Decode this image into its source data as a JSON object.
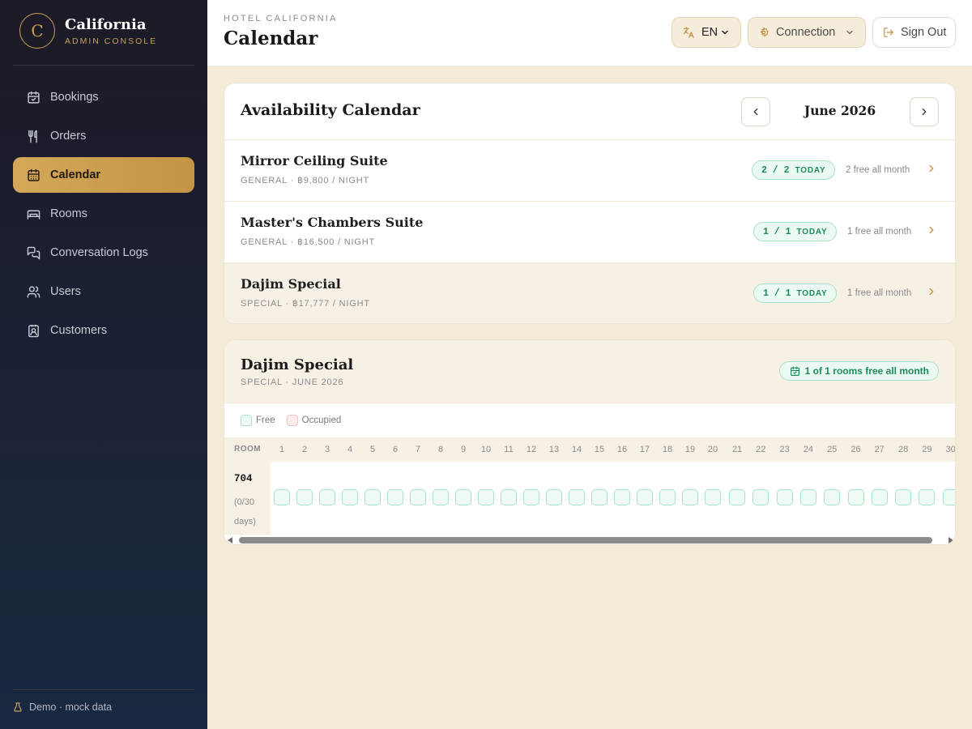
{
  "brand": {
    "logo_letter": "C",
    "title": "California",
    "subtitle": "ADMIN CONSOLE"
  },
  "nav": [
    {
      "label": "Bookings",
      "icon": "calendar-check-icon",
      "active": false
    },
    {
      "label": "Orders",
      "icon": "utensils-icon",
      "active": false
    },
    {
      "label": "Calendar",
      "icon": "calendar-icon",
      "active": true
    },
    {
      "label": "Rooms",
      "icon": "bed-icon",
      "active": false
    },
    {
      "label": "Conversation Logs",
      "icon": "chat-icon",
      "active": false
    },
    {
      "label": "Users",
      "icon": "users-icon",
      "active": false
    },
    {
      "label": "Customers",
      "icon": "contact-icon",
      "active": false
    }
  ],
  "footer": {
    "label": "Demo · mock data",
    "icon": "flask-icon"
  },
  "header": {
    "eyebrow": "HOTEL CALIFORNIA",
    "title": "Calendar",
    "lang_label": "EN",
    "connection_label": "Connection",
    "signout_label": "Sign Out"
  },
  "availability": {
    "title": "Availability Calendar",
    "month": "June 2026",
    "rooms": [
      {
        "name": "Mirror Ceiling Suite",
        "meta": "GENERAL · ฿9,800 / NIGHT",
        "badge": "2 / 2",
        "badge_suffix": "TODAY",
        "free_text": "2 free all month",
        "selected": false
      },
      {
        "name": "Master's Chambers Suite",
        "meta": "GENERAL · ฿16,500 / NIGHT",
        "badge": "1 / 1",
        "badge_suffix": "TODAY",
        "free_text": "1 free all month",
        "selected": false
      },
      {
        "name": "Dajim Special",
        "meta": "SPECIAL · ฿17,777 / NIGHT",
        "badge": "1 / 1",
        "badge_suffix": "TODAY",
        "free_text": "1 free all month",
        "selected": true
      }
    ]
  },
  "detail": {
    "title": "Dajim Special",
    "meta": "SPECIAL · JUNE 2026",
    "free_badge": "1 of 1 rooms free all month",
    "legend": {
      "free": "Free",
      "occupied": "Occupied"
    },
    "room_col_label": "ROOM",
    "days": [
      "1",
      "2",
      "3",
      "4",
      "5",
      "6",
      "7",
      "8",
      "9",
      "10",
      "11",
      "12",
      "13",
      "14",
      "15",
      "16",
      "17",
      "18",
      "19",
      "20",
      "21",
      "22",
      "23",
      "24",
      "25",
      "26",
      "27",
      "28",
      "29",
      "30"
    ],
    "room": {
      "number": "704",
      "days_text": "(0/30 days)"
    },
    "status": [
      "free",
      "free",
      "free",
      "free",
      "free",
      "free",
      "free",
      "free",
      "free",
      "free",
      "free",
      "free",
      "free",
      "free",
      "free",
      "free",
      "free",
      "free",
      "free",
      "free",
      "free",
      "free",
      "free",
      "free",
      "free",
      "free",
      "free",
      "free",
      "free",
      "free"
    ]
  },
  "colors": {
    "accent": "#c9a05a",
    "free": "#1f8b5a",
    "occupied": "#f1c2c2"
  }
}
